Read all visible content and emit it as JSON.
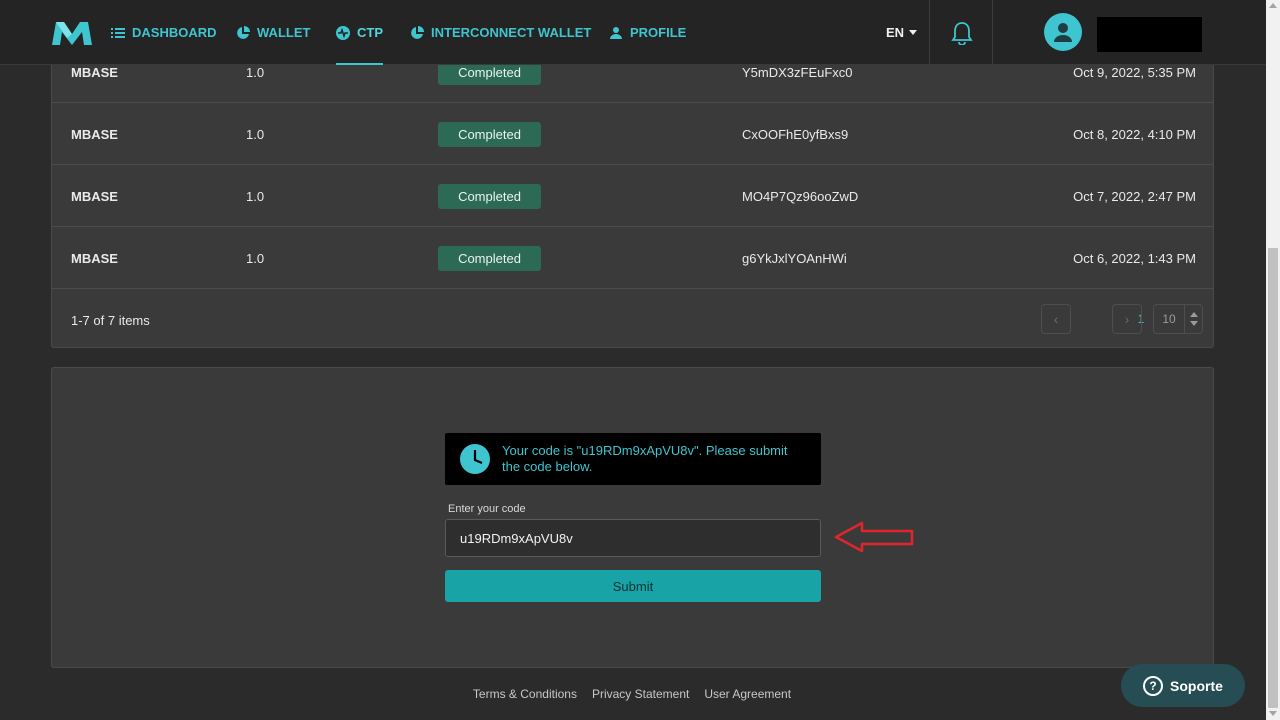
{
  "nav": {
    "items": [
      {
        "label": "DASHBOARD",
        "icon": "list-icon"
      },
      {
        "label": "WALLET",
        "icon": "pie-chart-icon"
      },
      {
        "label": "CTP",
        "icon": "activity-icon",
        "active": true
      },
      {
        "label": "INTERCONNECT WALLET",
        "icon": "pie-chart-icon"
      },
      {
        "label": "PROFILE",
        "icon": "user-icon"
      }
    ],
    "language": "EN"
  },
  "colors": {
    "accent": "#3ec5cf",
    "badge_completed": "#2c6a55",
    "submit": "#18a4a6",
    "arrow": "#e0262a",
    "background": "#2b2b2b",
    "panel": "#3a3a3a"
  },
  "table": {
    "rows": [
      {
        "asset": "MBASE",
        "amount": "1.0",
        "status": "Completed",
        "code": "Y5mDX3zFEuFxc0",
        "date": "Oct 9, 2022, 5:35 PM"
      },
      {
        "asset": "MBASE",
        "amount": "1.0",
        "status": "Completed",
        "code": "CxOOFhE0yfBxs9",
        "date": "Oct 8, 2022, 4:10 PM"
      },
      {
        "asset": "MBASE",
        "amount": "1.0",
        "status": "Completed",
        "code": "MO4P7Qz96ooZwD",
        "date": "Oct 7, 2022, 2:47 PM"
      },
      {
        "asset": "MBASE",
        "amount": "1.0",
        "status": "Completed",
        "code": "g6YkJxlYOAnHWi",
        "date": "Oct 6, 2022, 1:43 PM"
      }
    ],
    "items_count": "1-7 of 7 items",
    "pagination": {
      "current_page": "1",
      "page_size": "10"
    }
  },
  "code_form": {
    "notice": "Your code is \"u19RDm9xApVU8v\". Please submit the code below.",
    "label": "Enter your code",
    "value": "u19RDm9xApVU8v",
    "submit_label": "Submit"
  },
  "footer": {
    "links": [
      "Terms & Conditions",
      "Privacy Statement",
      "User Agreement"
    ]
  },
  "support": {
    "label": "Soporte"
  }
}
